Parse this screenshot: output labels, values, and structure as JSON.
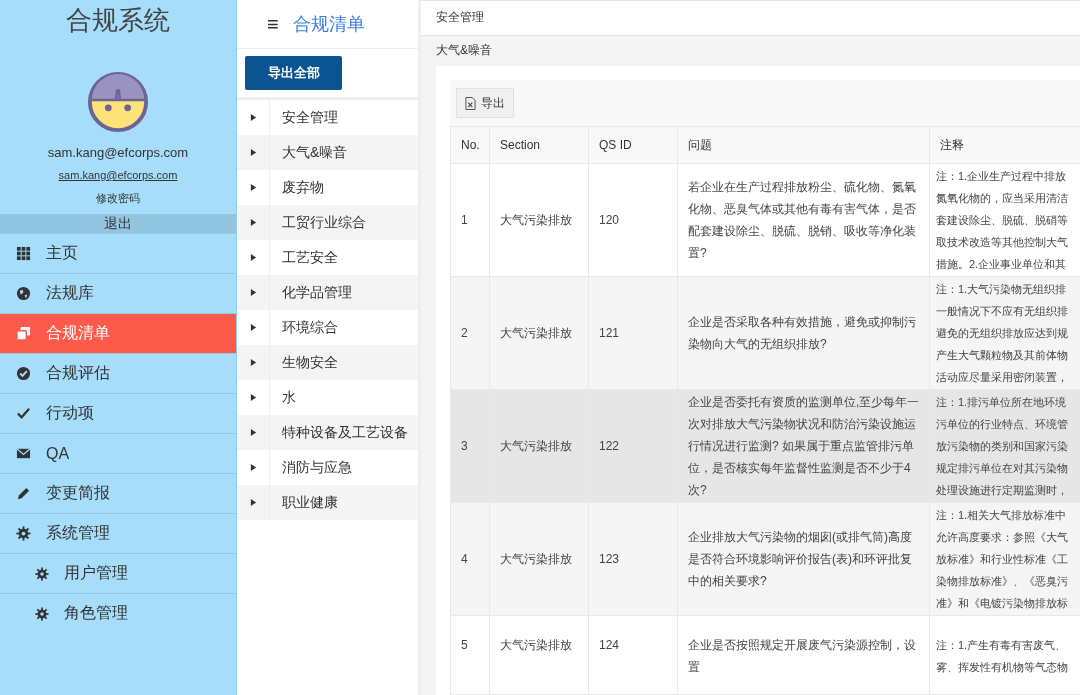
{
  "sidebar": {
    "app_title": "合规系统",
    "user_email": "sam.kang@efcorps.com",
    "user_link": "sam.kang@efcorps.com",
    "change_password": "修改密码",
    "logout": "退出",
    "menu": [
      {
        "label": "主页",
        "selected": false
      },
      {
        "label": "法规库",
        "selected": false
      },
      {
        "label": "合规清单",
        "selected": true
      },
      {
        "label": "合规评估",
        "selected": false
      },
      {
        "label": "行动项",
        "selected": false
      },
      {
        "label": "QA",
        "selected": false
      },
      {
        "label": "变更简报",
        "selected": false
      },
      {
        "label": "系统管理",
        "selected": false,
        "children": [
          {
            "label": "用户管理",
            "selected": false
          },
          {
            "label": "角色管理",
            "selected": false
          }
        ]
      }
    ]
  },
  "category_panel": {
    "menu_glyph": "≡",
    "title": "合规清单",
    "export_all_button": "导出全部",
    "categories": [
      {
        "label": "安全管理",
        "expanded": false
      },
      {
        "label": "大气&噪音",
        "expanded": false
      },
      {
        "label": "废弃物",
        "expanded": false
      },
      {
        "label": "工贸行业综合",
        "expanded": false
      },
      {
        "label": "工艺安全",
        "expanded": false
      },
      {
        "label": "化学品管理",
        "expanded": false
      },
      {
        "label": "环境综合",
        "expanded": false
      },
      {
        "label": "生物安全",
        "expanded": false
      },
      {
        "label": "水",
        "expanded": false
      },
      {
        "label": "特种设备及工艺设备",
        "expanded": false
      },
      {
        "label": "消防与应急",
        "expanded": false
      },
      {
        "label": "职业健康",
        "expanded": false
      }
    ]
  },
  "content": {
    "breadcrumbs": [
      "安全管理",
      "大气&噪音"
    ],
    "export_button": "导出",
    "table": {
      "columns": [
        "No.",
        "Section",
        "QS ID",
        "问题",
        "注释"
      ],
      "rows": [
        {
          "no": "1",
          "section": "大气污染排放",
          "qs_id": "120",
          "question": "若企业在生产过程排放粉尘、硫化物、氮氧化物、恶臭气体或其他有毒有害气体，是否配套建设除尘、脱硫、脱销、吸收等净化装置?",
          "note_lines": [
            "注：1.企业生产过程中排放",
            "氮氧化物的，应当采用清洁",
            "套建设除尘、脱硫、脱硝等",
            "取技术改造等其他控制大气",
            "措施。2.企业事业单位和其"
          ],
          "hovered": false
        },
        {
          "no": "2",
          "section": "大气污染排放",
          "qs_id": "121",
          "question": "企业是否采取各种有效措施，避免或抑制污染物向大气的无组织排放?",
          "note_lines": [
            "注：1.大气污染物无组织排",
            "一般情况下不应有无组织排",
            "避免的无组织排放应达到规",
            "产生大气颗粒物及其前体物",
            "活动应尽量采用密闭装置，"
          ],
          "hovered": false
        },
        {
          "no": "3",
          "section": "大气污染排放",
          "qs_id": "122",
          "question": "企业是否委托有资质的监测单位,至少每年一次对排放大气污染物状况和防治污染设施运行情况进行监测? 如果属于重点监管排污单位，是否核实每年监督性监测是否不少于4 次?",
          "note_lines": [
            "注：1.排污单位所在地环境",
            "污单位的行业特点、环境管",
            "放污染物的类别和国家污染",
            "规定排污单位在对其污染物",
            "处理设施进行定期监测时，"
          ],
          "hovered": true
        },
        {
          "no": "4",
          "section": "大气污染排放",
          "qs_id": "123",
          "question": "企业排放大气污染物的烟囱(或排气筒)高度是否符合环境影响评价报告(表)和环评批复中的相关要求?",
          "note_lines": [
            "注：1.相关大气排放标准中",
            "允许高度要求：参照《大气",
            "放标准》和行业性标准《工",
            "染物排放标准》、《恶臭污",
            "准》和《电镀污染物排放标"
          ],
          "hovered": false
        },
        {
          "no": "5",
          "section": "大气污染排放",
          "qs_id": "124",
          "question": "企业是否按照规定开展废气污染源控制，设置",
          "note_lines": [
            "注：1.产生有毒有害废气、",
            "雾、挥发性有机物等气态物"
          ],
          "hovered": false
        }
      ]
    }
  }
}
